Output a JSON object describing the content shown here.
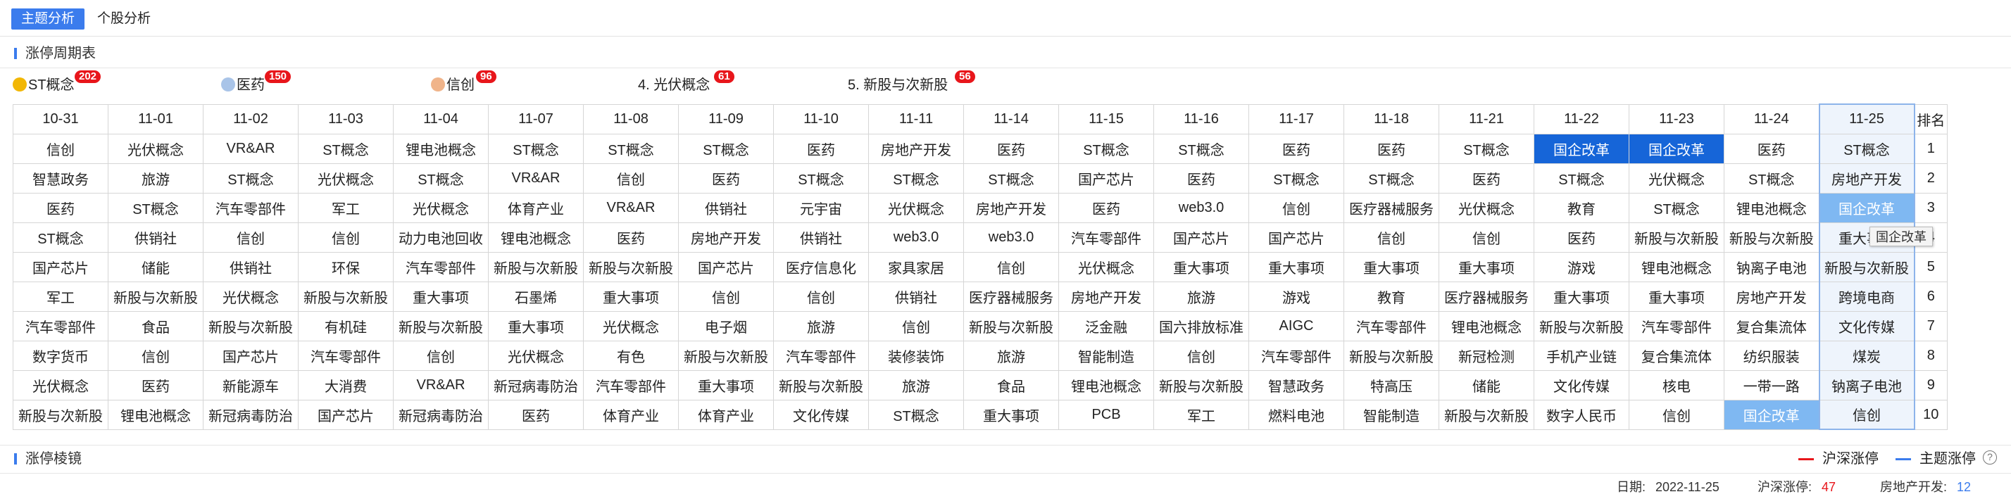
{
  "tabs": [
    {
      "label": "主题分析",
      "active": true
    },
    {
      "label": "个股分析",
      "active": false
    }
  ],
  "section_title": "涨停周期表",
  "legend": [
    {
      "label": "ST概念",
      "count": "202",
      "icon": "gold-medal-icon",
      "color": "#f2b705"
    },
    {
      "label": "医药",
      "count": "150",
      "icon": "silver-medal-icon",
      "color": "#a9c4e8"
    },
    {
      "label": "信创",
      "count": "96",
      "icon": "bronze-medal-icon",
      "color": "#f0b48a"
    },
    {
      "label": "4. 光伏概念",
      "count": "61"
    },
    {
      "label": "5. 新股与次新股",
      "count": "56"
    }
  ],
  "table": {
    "headers": [
      "10-31",
      "11-01",
      "11-02",
      "11-03",
      "11-04",
      "11-07",
      "11-08",
      "11-09",
      "11-10",
      "11-11",
      "11-14",
      "11-15",
      "11-16",
      "11-17",
      "11-18",
      "11-21",
      "11-22",
      "11-23",
      "11-24",
      "11-25",
      "排名"
    ],
    "rows": [
      [
        "信创",
        "光伏概念",
        "VR&AR",
        "ST概念",
        "锂电池概念",
        "ST概念",
        "ST概念",
        "ST概念",
        "医药",
        "房地产开发",
        "医药",
        "ST概念",
        "ST概念",
        "医药",
        "医药",
        "ST概念",
        "国企改革",
        "国企改革",
        "医药",
        "ST概念",
        "1"
      ],
      [
        "智慧政务",
        "旅游",
        "ST概念",
        "光伏概念",
        "ST概念",
        "VR&AR",
        "信创",
        "医药",
        "ST概念",
        "ST概念",
        "ST概念",
        "国产芯片",
        "医药",
        "ST概念",
        "ST概念",
        "医药",
        "ST概念",
        "光伏概念",
        "ST概念",
        "房地产开发",
        "2"
      ],
      [
        "医药",
        "ST概念",
        "汽车零部件",
        "军工",
        "光伏概念",
        "体育产业",
        "VR&AR",
        "供销社",
        "元宇宙",
        "光伏概念",
        "房地产开发",
        "医药",
        "web3.0",
        "信创",
        "医疗器械服务",
        "光伏概念",
        "教育",
        "ST概念",
        "锂电池概念",
        "国企改革",
        "3"
      ],
      [
        "ST概念",
        "供销社",
        "信创",
        "信创",
        "动力电池回收",
        "锂电池概念",
        "医药",
        "房地产开发",
        "供销社",
        "web3.0",
        "web3.0",
        "汽车零部件",
        "国产芯片",
        "国产芯片",
        "信创",
        "信创",
        "医药",
        "新股与次新股",
        "新股与次新股",
        "重大事项",
        "4"
      ],
      [
        "国产芯片",
        "储能",
        "供销社",
        "环保",
        "汽车零部件",
        "新股与次新股",
        "新股与次新股",
        "国产芯片",
        "医疗信息化",
        "家具家居",
        "信创",
        "光伏概念",
        "重大事项",
        "重大事项",
        "重大事项",
        "重大事项",
        "游戏",
        "锂电池概念",
        "钠离子电池",
        "新股与次新股",
        "5"
      ],
      [
        "军工",
        "新股与次新股",
        "光伏概念",
        "新股与次新股",
        "重大事项",
        "石墨烯",
        "重大事项",
        "信创",
        "信创",
        "供销社",
        "医疗器械服务",
        "房地产开发",
        "旅游",
        "游戏",
        "教育",
        "医疗器械服务",
        "重大事项",
        "重大事项",
        "房地产开发",
        "跨境电商",
        "6"
      ],
      [
        "汽车零部件",
        "食品",
        "新股与次新股",
        "有机硅",
        "新股与次新股",
        "重大事项",
        "光伏概念",
        "电子烟",
        "旅游",
        "信创",
        "新股与次新股",
        "泛金融",
        "国六排放标准",
        "AIGC",
        "汽车零部件",
        "锂电池概念",
        "新股与次新股",
        "汽车零部件",
        "复合集流体",
        "文化传媒",
        "7"
      ],
      [
        "数字货币",
        "信创",
        "国产芯片",
        "汽车零部件",
        "信创",
        "光伏概念",
        "有色",
        "新股与次新股",
        "汽车零部件",
        "装修装饰",
        "旅游",
        "智能制造",
        "信创",
        "汽车零部件",
        "新股与次新股",
        "新冠检测",
        "手机产业链",
        "复合集流体",
        "纺织服装",
        "煤炭",
        "8"
      ],
      [
        "光伏概念",
        "医药",
        "新能源车",
        "大消费",
        "VR&AR",
        "新冠病毒防治",
        "汽车零部件",
        "重大事项",
        "新股与次新股",
        "旅游",
        "食品",
        "锂电池概念",
        "新股与次新股",
        "智慧政务",
        "特高压",
        "储能",
        "文化传媒",
        "核电",
        "一带一路",
        "钠离子电池",
        "9"
      ],
      [
        "新股与次新股",
        "锂电池概念",
        "新冠病毒防治",
        "国产芯片",
        "新冠病毒防治",
        "医药",
        "体育产业",
        "体育产业",
        "文化传媒",
        "ST概念",
        "重大事项",
        "PCB",
        "军工",
        "燃料电池",
        "智能制造",
        "新股与次新股",
        "数字人民币",
        "信创",
        "国企改革",
        "信创",
        "10"
      ]
    ],
    "highlight_dark": [
      [
        0,
        16
      ],
      [
        0,
        17
      ]
    ],
    "highlight_light": [
      [
        2,
        19
      ],
      [
        9,
        18
      ]
    ]
  },
  "tooltip": "国企改革",
  "section2_title": "涨停棱镜",
  "chart_legend": [
    {
      "label": "沪深涨停",
      "color": "#e8161b"
    },
    {
      "label": "主题涨停",
      "color": "#3b7ced"
    }
  ],
  "help_icon": "question-circle-icon",
  "footer": {
    "date_label": "日期:",
    "date_value": "2022-11-25",
    "hs_label": "沪深涨停:",
    "hs_value": "47",
    "hs_color": "#e8161b",
    "theme_label": "房地产开发:",
    "theme_value": "12",
    "theme_color": "#3b7ced"
  }
}
